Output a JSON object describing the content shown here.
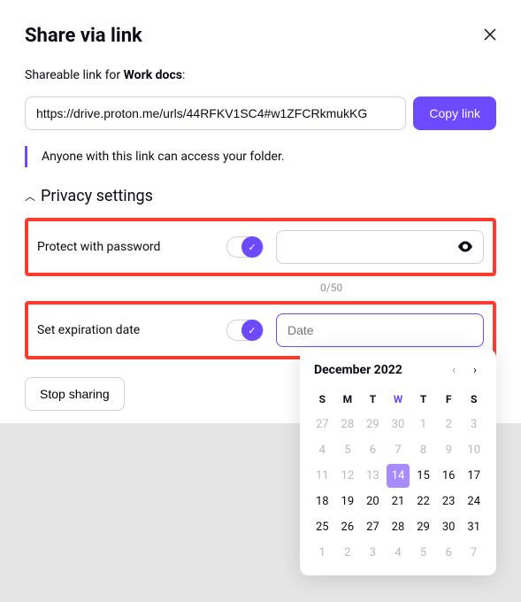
{
  "header": {
    "title": "Share via link"
  },
  "subtitle": {
    "prefix": "Shareable link for ",
    "item": "Work docs",
    "suffix": ":"
  },
  "link": {
    "url": "https://drive.proton.me/urls/44RFKV1SC4#w1ZFCRkmukKG",
    "copy_label": "Copy link"
  },
  "info": "Anyone with this link can access your folder.",
  "privacy": {
    "section_title": "Privacy settings",
    "password": {
      "label": "Protect with password",
      "counter": "0/50"
    },
    "expiration": {
      "label": "Set expiration date",
      "placeholder": "Date"
    }
  },
  "stop_sharing_label": "Stop sharing",
  "calendar": {
    "month_title": "December 2022",
    "dow": [
      "S",
      "M",
      "T",
      "W",
      "T",
      "F",
      "S"
    ],
    "today_col": 3,
    "weeks": [
      [
        {
          "d": 27,
          "m": true
        },
        {
          "d": 28,
          "m": true
        },
        {
          "d": 29,
          "m": true
        },
        {
          "d": 30,
          "m": true
        },
        {
          "d": 1,
          "m": true
        },
        {
          "d": 2,
          "m": true
        },
        {
          "d": 3,
          "m": true
        }
      ],
      [
        {
          "d": 4,
          "m": true
        },
        {
          "d": 5,
          "m": true
        },
        {
          "d": 6,
          "m": true
        },
        {
          "d": 7,
          "m": true
        },
        {
          "d": 8,
          "m": true
        },
        {
          "d": 9,
          "m": true
        },
        {
          "d": 10,
          "m": true
        }
      ],
      [
        {
          "d": 11,
          "m": true
        },
        {
          "d": 12,
          "m": true
        },
        {
          "d": 13,
          "m": true
        },
        {
          "d": 14,
          "sel": true
        },
        {
          "d": 15
        },
        {
          "d": 16
        },
        {
          "d": 17
        }
      ],
      [
        {
          "d": 18
        },
        {
          "d": 19
        },
        {
          "d": 20
        },
        {
          "d": 21
        },
        {
          "d": 22
        },
        {
          "d": 23
        },
        {
          "d": 24
        }
      ],
      [
        {
          "d": 25
        },
        {
          "d": 26
        },
        {
          "d": 27
        },
        {
          "d": 28
        },
        {
          "d": 29
        },
        {
          "d": 30
        },
        {
          "d": 31
        }
      ],
      [
        {
          "d": 1,
          "m": true
        },
        {
          "d": 2,
          "m": true
        },
        {
          "d": 3,
          "m": true
        },
        {
          "d": 4,
          "m": true
        },
        {
          "d": 5,
          "m": true
        },
        {
          "d": 6,
          "m": true
        },
        {
          "d": 7,
          "m": true
        }
      ]
    ]
  }
}
